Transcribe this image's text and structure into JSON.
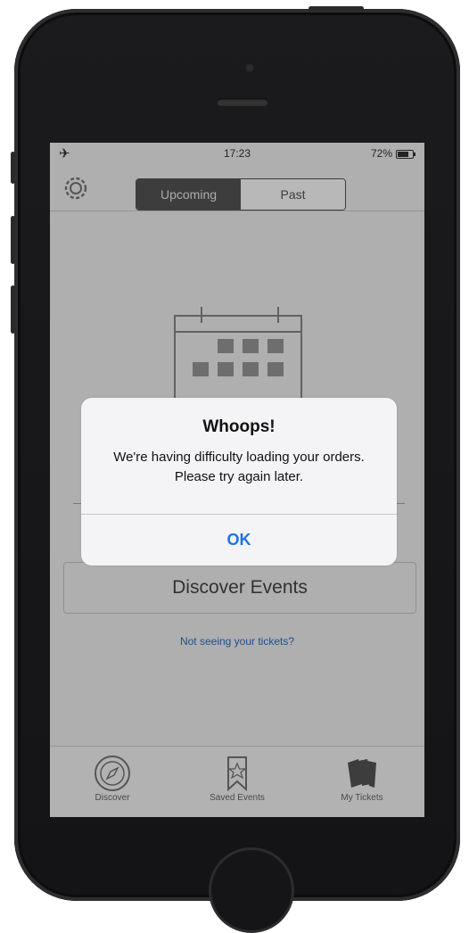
{
  "status_bar": {
    "airplane_icon": "airplane-icon",
    "time": "17:23",
    "battery": "72%"
  },
  "nav": {
    "settings_icon": "gear-icon",
    "segments": [
      "Upcoming",
      "Past"
    ],
    "selected_segment": "Upcoming"
  },
  "empty_state": {
    "illustration": "calendar-icon"
  },
  "discover_button": {
    "label": "Discover Events"
  },
  "help_link": {
    "label": "Not seeing your tickets?"
  },
  "tab_bar": {
    "tabs": [
      {
        "label": "Discover",
        "icon": "compass-icon"
      },
      {
        "label": "Saved Events",
        "icon": "bookmark-star-icon"
      },
      {
        "label": "My Tickets",
        "icon": "tickets-icon"
      }
    ]
  },
  "alert": {
    "title": "Whoops!",
    "message": "We're having difficulty loading your orders. Please try again later.",
    "ok_label": "OK"
  },
  "colors": {
    "link_blue": "#2a6fc4",
    "alert_button_blue": "#1f73d8"
  }
}
